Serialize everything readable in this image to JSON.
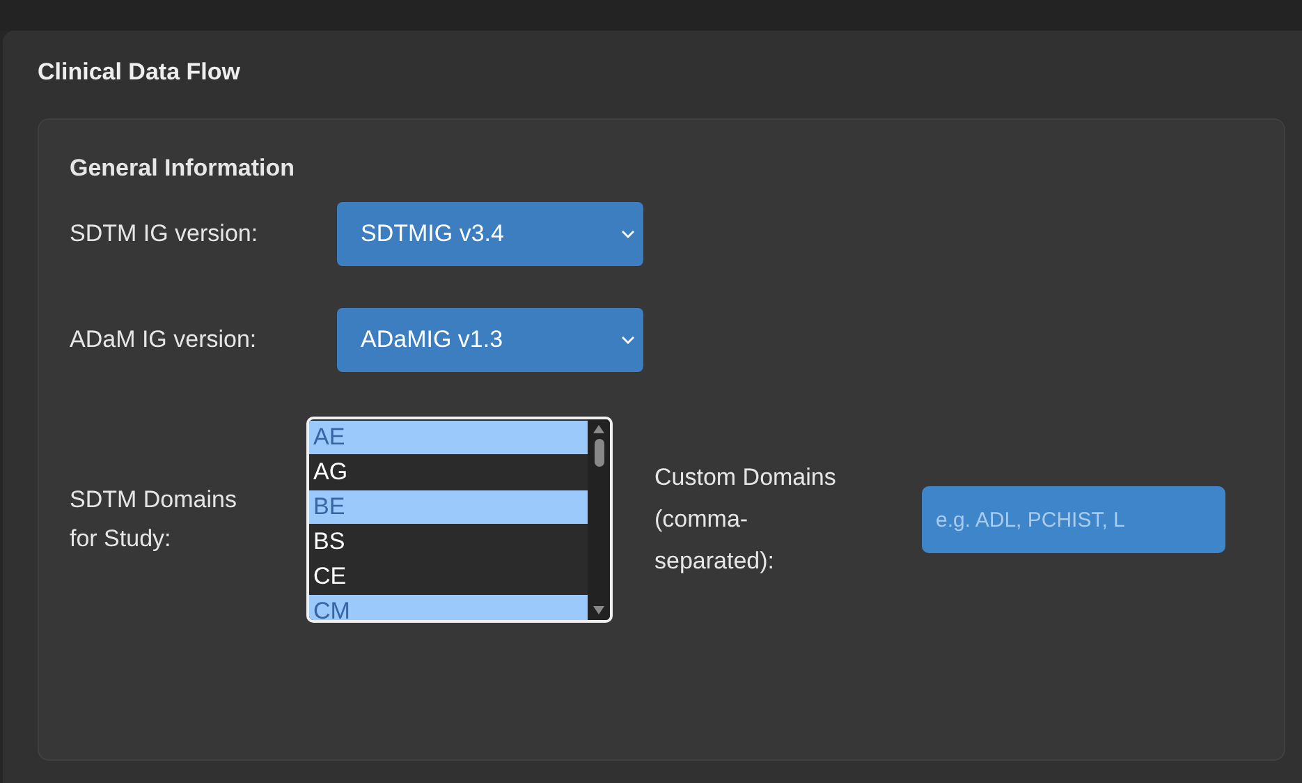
{
  "panel": {
    "title": "Clinical Data Flow"
  },
  "section": {
    "title": "General Information"
  },
  "selects": [
    {
      "label": "SDTM IG version:",
      "value": "SDTMIG v3.4"
    },
    {
      "label": "ADaM IG version:",
      "value": "ADaMIG v1.3"
    }
  ],
  "domains": {
    "label": "SDTM Domains for Study:",
    "items": [
      {
        "label": "AE",
        "selected": true
      },
      {
        "label": "AG",
        "selected": false
      },
      {
        "label": "BE",
        "selected": true
      },
      {
        "label": "BS",
        "selected": false
      },
      {
        "label": "CE",
        "selected": false
      },
      {
        "label": "CM",
        "selected": true
      }
    ]
  },
  "custom": {
    "label": "Custom Domains (comma-separated):",
    "placeholder": "e.g. ADL, PCHIST, L"
  }
}
